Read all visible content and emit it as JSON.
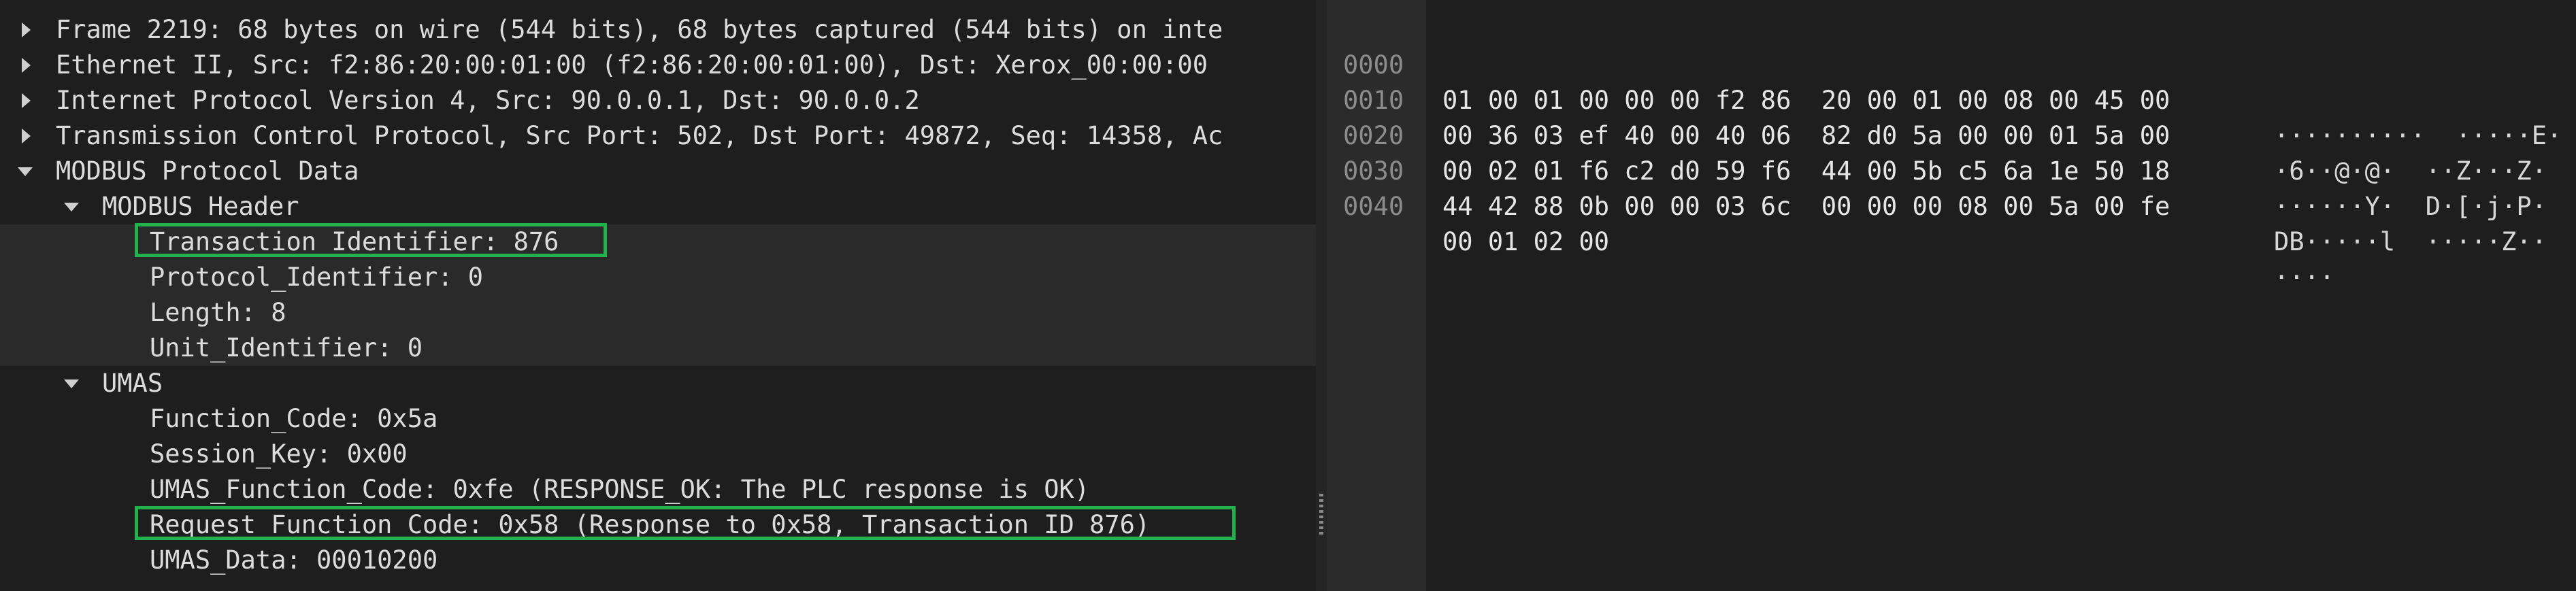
{
  "tree": [
    {
      "label": "Frame 2219: 68 bytes on wire (544 bits), 68 bytes captured (544 bits) on inte",
      "expanded": false
    },
    {
      "label": "Ethernet II, Src: f2:86:20:00:01:00 (f2:86:20:00:01:00), Dst: Xerox_00:00:00",
      "expanded": false
    },
    {
      "label": "Internet Protocol Version 4, Src: 90.0.0.1, Dst: 90.0.0.2",
      "expanded": false
    },
    {
      "label": "Transmission Control Protocol, Src Port: 502, Dst Port: 49872, Seq: 14358, Ac",
      "expanded": false
    },
    {
      "label": "MODBUS Protocol Data",
      "expanded": true
    },
    {
      "label": "MODBUS Header",
      "expanded": true
    },
    {
      "label": "Transaction_Identifier: 876",
      "highlighted": true
    },
    {
      "label": "Protocol_Identifier: 0"
    },
    {
      "label": "Length: 8"
    },
    {
      "label": "Unit_Identifier: 0"
    },
    {
      "label": "UMAS",
      "expanded": true
    },
    {
      "label": "Function_Code: 0x5a"
    },
    {
      "label": "Session_Key: 0x00"
    },
    {
      "label": "UMAS_Function_Code: 0xfe (RESPONSE_OK: The PLC response is OK)"
    },
    {
      "label": "Request_Function_Code: 0x58 (Response to 0x58, Transaction_ID 876)",
      "highlighted": true
    },
    {
      "label": "UMAS_Data: 00010200"
    }
  ],
  "bytes": [
    {
      "offset": "0000",
      "hex": "01 00 01 00 00 00 f2 86  20 00 01 00 08 00 45 00",
      "ascii": "··········  ·····E·"
    },
    {
      "offset": "0010",
      "hex": "00 36 03 ef 40 00 40 06  82 d0 5a 00 00 01 5a 00",
      "ascii": "·6··@·@·  ··Z···Z·"
    },
    {
      "offset": "0020",
      "hex": "00 02 01 f6 c2 d0 59 f6  44 00 5b c5 6a 1e 50 18",
      "ascii": "······Y·  D·[·j·P·"
    },
    {
      "offset": "0030",
      "hex": "44 42 88 0b 00 00 03 6c  00 00 00 08 00 5a 00 fe",
      "ascii": "DB·····l  ·····Z··"
    },
    {
      "offset": "0040",
      "hex": "00 01 02 00",
      "ascii": "····"
    }
  ],
  "colors": {
    "background": "#1e1e1e",
    "highlight_border": "#22b14c",
    "text": "#dcdcdc",
    "offset_text": "#8c8c8c"
  }
}
